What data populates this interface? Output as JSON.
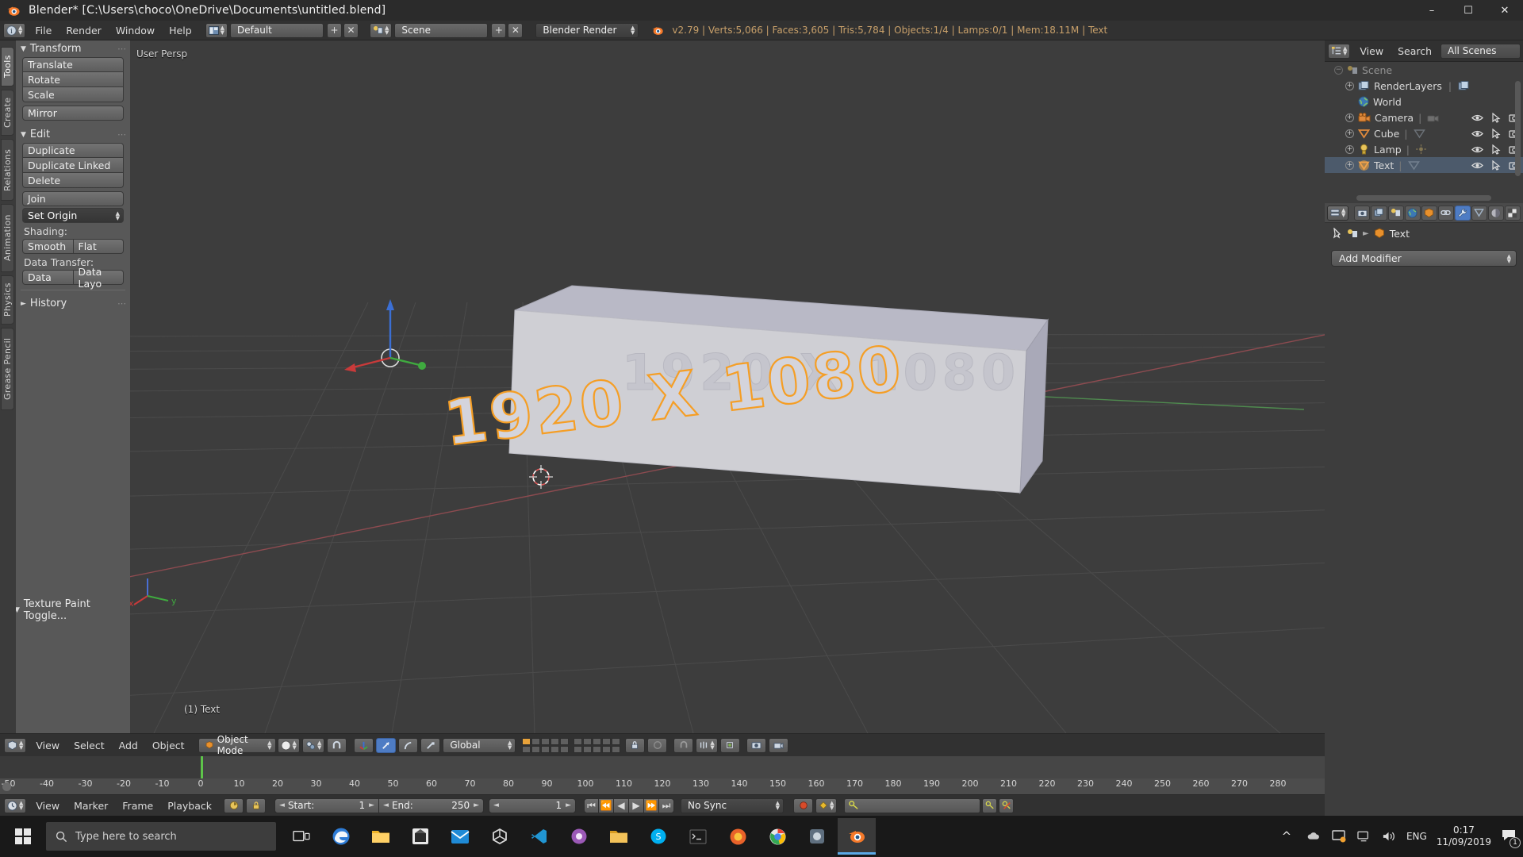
{
  "window": {
    "title": "Blender* [C:\\Users\\choco\\OneDrive\\Documents\\untitled.blend]",
    "minimize": "–",
    "maximize": "☐",
    "close": "✕"
  },
  "topbar": {
    "menus": [
      "File",
      "Render",
      "Window",
      "Help"
    ],
    "screen_layout": "Default",
    "add_screen": "+",
    "delete_screen": "✕",
    "scene_name": "Scene",
    "add_scene": "+",
    "delete_scene": "✕",
    "render_engine": "Blender Render",
    "stats": "v2.79 | Verts:5,066 | Faces:3,605 | Tris:5,784 | Objects:1/4 | Lamps:0/1 | Mem:18.11M | Text"
  },
  "toolshelf": {
    "tabs": [
      "Tools",
      "Create",
      "Relations",
      "Animation",
      "Physics",
      "Grease Pencil"
    ],
    "active_tab": "Tools",
    "transform": {
      "title": "Transform",
      "buttons": [
        "Translate",
        "Rotate",
        "Scale",
        "Mirror"
      ]
    },
    "edit": {
      "title": "Edit",
      "buttons": [
        "Duplicate",
        "Duplicate Linked",
        "Delete",
        "Join"
      ],
      "set_origin": "Set Origin",
      "shading_label": "Shading:",
      "shading_buttons": [
        "Smooth",
        "Flat"
      ],
      "data_transfer_label": "Data Transfer:",
      "data_transfer_buttons": [
        "Data",
        "Data Layo"
      ]
    },
    "history": "History",
    "texture_paint_toggle": "Texture Paint Toggle..."
  },
  "viewport": {
    "view_name": "User Persp",
    "object_info": "(1) Text",
    "axis_x": "x",
    "axis_y": "y",
    "text_object_content": "1920 X 1080"
  },
  "viewport_header": {
    "menus": [
      "View",
      "Select",
      "Add",
      "Object"
    ],
    "mode": "Object Mode",
    "transform_orientation": "Global"
  },
  "timeline": {
    "menus": [
      "View",
      "Marker",
      "Frame",
      "Playback"
    ],
    "start_label": "Start:",
    "start_value": "1",
    "end_label": "End:",
    "end_value": "250",
    "current_frame": "1",
    "sync_mode": "No Sync",
    "ruler_ticks": [
      "-50",
      "-40",
      "-30",
      "-20",
      "-10",
      "0",
      "10",
      "20",
      "30",
      "40",
      "50",
      "60",
      "70",
      "80",
      "90",
      "100",
      "110",
      "120",
      "130",
      "140",
      "150",
      "160",
      "170",
      "180",
      "190",
      "200",
      "210",
      "220",
      "230",
      "240",
      "250",
      "260",
      "270",
      "280"
    ],
    "transport": [
      "⏮",
      "⏪",
      "◀",
      "▶",
      "⏩",
      "⏭"
    ]
  },
  "outliner": {
    "header_menus": [
      "View",
      "Search"
    ],
    "scene_filter": "All Scenes",
    "root": "Scene",
    "items": [
      {
        "label": "RenderLayers",
        "icon": "renderlayers-icon",
        "selected": false,
        "depth": 1,
        "expandable": true
      },
      {
        "label": "World",
        "icon": "world-icon",
        "selected": false,
        "depth": 2,
        "expandable": false
      },
      {
        "label": "Camera",
        "icon": "camera-icon",
        "selected": false,
        "depth": 1,
        "expandable": true
      },
      {
        "label": "Cube",
        "icon": "mesh-icon",
        "selected": false,
        "depth": 1,
        "expandable": true
      },
      {
        "label": "Lamp",
        "icon": "lamp-icon",
        "selected": false,
        "depth": 1,
        "expandable": true
      },
      {
        "label": "Text",
        "icon": "font-icon",
        "selected": true,
        "depth": 1,
        "expandable": true
      }
    ]
  },
  "properties": {
    "active_tab": "modifier-tab",
    "breadcrumb_object": "Text",
    "add_modifier": "Add Modifier"
  },
  "taskbar": {
    "search_placeholder": "Type here to search",
    "language": "ENG",
    "time": "0:17",
    "date": "11/09/2019",
    "notification_count": "1"
  },
  "colors": {
    "accent": "#4e7cc4",
    "header_bg": "#313131",
    "panel_bg": "#585858",
    "viewport_bg": "#3d3d3d",
    "stats_text": "#c8a06a",
    "playhead": "#5ec44a",
    "selected_outline": "#f59e25"
  }
}
